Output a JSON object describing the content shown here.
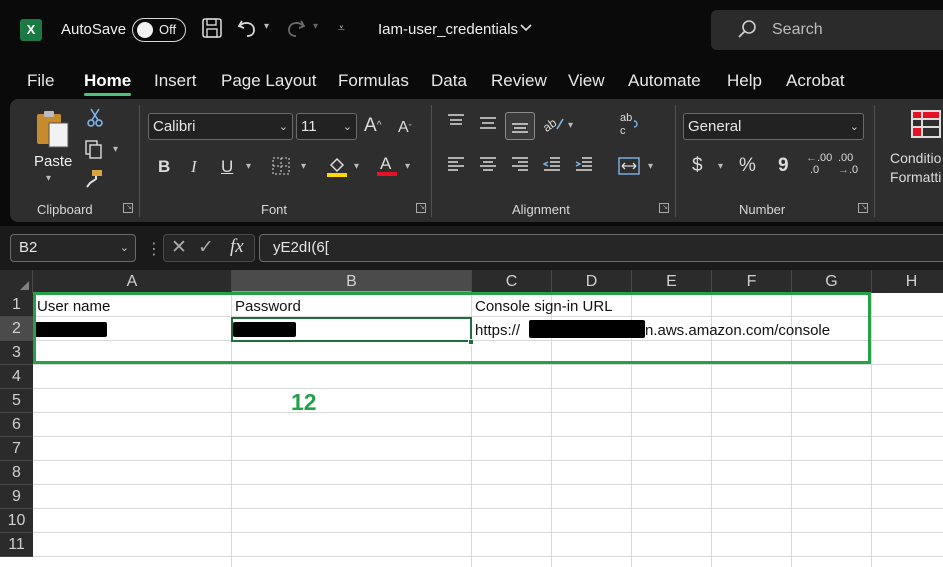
{
  "titlebar": {
    "app_icon": "excel-logo",
    "app_icon_text": "X",
    "autosave_label": "AutoSave",
    "autosave_state": "Off",
    "icons": [
      "save-icon",
      "undo-icon",
      "redo-icon",
      "customize-qat-icon"
    ],
    "file_name": "Iam-user_credentials",
    "search_placeholder": "Search"
  },
  "menu": {
    "tabs": [
      "File",
      "Home",
      "Insert",
      "Page Layout",
      "Formulas",
      "Data",
      "Review",
      "View",
      "Automate",
      "Help",
      "Acrobat"
    ],
    "active_tab": "Home",
    "accent": "#4fc37a"
  },
  "ribbon": {
    "clipboard": {
      "label": "Clipboard",
      "paste_label": "Paste"
    },
    "font": {
      "label": "Font",
      "font_name": "Calibri",
      "font_size": "11",
      "bold": "B",
      "italic": "I",
      "underline": "U",
      "highlight_color": "#ffd800",
      "font_color": "#e81123"
    },
    "alignment": {
      "label": "Alignment"
    },
    "number": {
      "label": "Number",
      "format": "General",
      "currency": "$",
      "percent": "%",
      "comma": "9",
      "increase_decimal": ".00",
      "decrease_decimal": ".00"
    },
    "styles": {
      "conditional_formatting": [
        "Conditio",
        "Formatti"
      ]
    }
  },
  "formula_bar": {
    "name_box": "B2",
    "formula": "yE2dI(6[",
    "fx": "fx"
  },
  "grid": {
    "columns": [
      "A",
      "B",
      "C",
      "D",
      "E",
      "F",
      "G",
      "H"
    ],
    "rows": [
      "1",
      "2",
      "3",
      "4",
      "5",
      "6",
      "7",
      "8",
      "9",
      "10",
      "11"
    ],
    "selected_column": "B",
    "selected_row": "2",
    "cells": {
      "A1": "User name",
      "B1": "Password",
      "C1": "Console sign-in URL",
      "C2_prefix": "https://",
      "C2_suffix": ".aws.amazon.com/console",
      "C2_suffix_visible": "n.aws.amazon.com/console"
    },
    "annotation": "12",
    "annotation_color": "#27a04a"
  }
}
